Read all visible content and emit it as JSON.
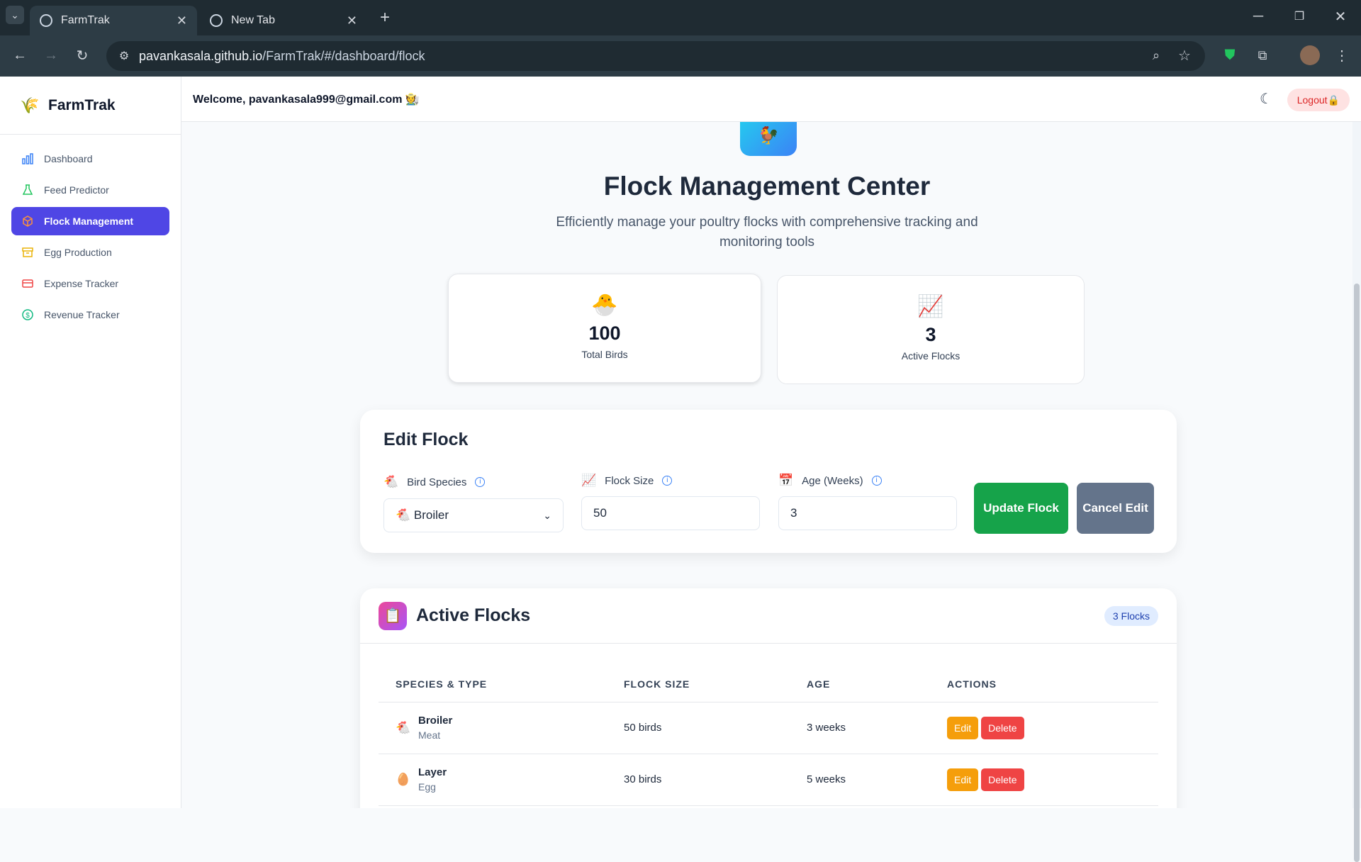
{
  "browser": {
    "tabs": [
      {
        "title": "FarmTrak",
        "active": true
      },
      {
        "title": "New Tab",
        "active": false
      }
    ],
    "url_host": "pavankasala.github.io",
    "url_path": "/FarmTrak/#/dashboard/flock"
  },
  "sidebar": {
    "brand": "FarmTrak",
    "items": [
      {
        "label": "Dashboard",
        "icon": "bar-chart-icon",
        "active": false
      },
      {
        "label": "Feed Predictor",
        "icon": "flask-icon",
        "active": false
      },
      {
        "label": "Flock Management",
        "icon": "box-icon",
        "active": true
      },
      {
        "label": "Egg Production",
        "icon": "archive-icon",
        "active": false
      },
      {
        "label": "Expense Tracker",
        "icon": "credit-card-icon",
        "active": false
      },
      {
        "label": "Revenue Tracker",
        "icon": "dollar-circle-icon",
        "active": false
      }
    ]
  },
  "topbar": {
    "welcome": "Welcome, pavankasala999@gmail.com 🧑‍🌾",
    "logout_label": "Logout🔒"
  },
  "hero": {
    "title": "Flock Management Center",
    "subtitle": "Efficiently manage your poultry flocks with comprehensive tracking and monitoring tools"
  },
  "stats": [
    {
      "icon": "🐣",
      "value": "100",
      "label": "Total Birds"
    },
    {
      "icon": "📈",
      "value": "3",
      "label": "Active Flocks"
    }
  ],
  "edit_form": {
    "title": "Edit Flock",
    "species_label": "Bird Species",
    "species_value": "🐔 Broiler",
    "size_label": "Flock Size",
    "size_value": "50",
    "age_label": "Age (Weeks)",
    "age_value": "3",
    "update_label": "Update Flock",
    "cancel_label": "Cancel Edit"
  },
  "flocks": {
    "title": "Active Flocks",
    "badge": "3 Flocks",
    "columns": [
      "SPECIES & TYPE",
      "FLOCK SIZE",
      "AGE",
      "ACTIONS"
    ],
    "rows": [
      {
        "icon": "🐔",
        "species": "Broiler",
        "type": "Meat",
        "size": "50 birds",
        "age": "3 weeks"
      },
      {
        "icon": "🥚",
        "species": "Layer",
        "type": "Egg",
        "size": "30 birds",
        "age": "5 weeks"
      }
    ],
    "edit_label": "Edit",
    "delete_label": "Delete"
  },
  "colors": {
    "accent": "#4f46e5",
    "update_button": "#16a34a",
    "cancel_button": "#64748b",
    "edit_action": "#f59e0b",
    "delete_action": "#ef4444"
  }
}
